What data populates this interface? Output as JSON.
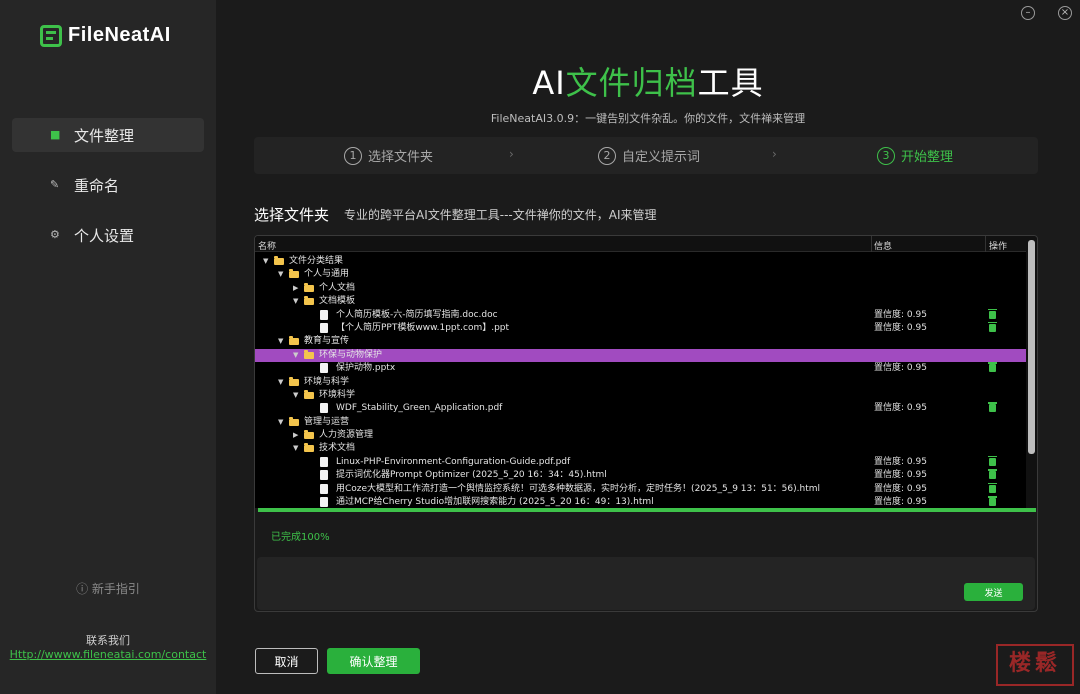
{
  "app": {
    "name": "FileNeatAI",
    "title_prefix": "AI",
    "title_green": "文件归档",
    "title_suffix": "工具",
    "subtitle": "FileNeatAI3.0.9：一键告别文件杂乱。你的文件，文件禅来管理"
  },
  "sidebar": {
    "items": [
      {
        "label": "文件整理",
        "icon": "folder-icon",
        "active": true
      },
      {
        "label": "重命名",
        "icon": "edit-icon",
        "active": false
      },
      {
        "label": "个人设置",
        "icon": "gear-icon",
        "active": false
      }
    ],
    "guide": "新手指引",
    "contact_title": "联系我们",
    "contact_link": "Http://wwww.fileneatai.com/contact"
  },
  "steps": [
    {
      "num": "1",
      "label": "选择文件夹"
    },
    {
      "num": "2",
      "label": "自定义提示词"
    },
    {
      "num": "3",
      "label": "开始整理"
    }
  ],
  "section": {
    "title": "选择文件夹",
    "desc": "专业的跨平台AI文件整理工具---文件禅你的文件，AI来管理"
  },
  "tree": {
    "headers": {
      "name": "名称",
      "info": "信息",
      "action": "操作"
    },
    "rows": [
      {
        "name": "文件分类结果",
        "kind": "folder",
        "level": 0,
        "arrow": "▼",
        "info": ""
      },
      {
        "name": "个人与通用",
        "kind": "folder",
        "level": 1,
        "arrow": "▼",
        "info": ""
      },
      {
        "name": "个人文档",
        "kind": "folder",
        "level": 2,
        "arrow": "▶",
        "info": ""
      },
      {
        "name": "文档模板",
        "kind": "folder",
        "level": 2,
        "arrow": "▼",
        "info": ""
      },
      {
        "name": "个人简历模板-六-简历填写指南.doc.doc",
        "kind": "file",
        "level": 3,
        "info": "置信度: 0.95"
      },
      {
        "name": "【个人简历PPT模板www.1ppt.com】.ppt",
        "kind": "file",
        "level": 3,
        "info": "置信度: 0.95"
      },
      {
        "name": "教育与宣传",
        "kind": "folder",
        "level": 1,
        "arrow": "▼",
        "info": ""
      },
      {
        "name": "环保与动物保护",
        "kind": "folder",
        "level": 2,
        "arrow": "▼",
        "info": "",
        "selected": true
      },
      {
        "name": "保护动物.pptx",
        "kind": "file",
        "level": 3,
        "info": "置信度: 0.95"
      },
      {
        "name": "环境与科学",
        "kind": "folder",
        "level": 1,
        "arrow": "▼",
        "info": ""
      },
      {
        "name": "环境科学",
        "kind": "folder",
        "level": 2,
        "arrow": "▼",
        "info": ""
      },
      {
        "name": "WDF_Stability_Green_Application.pdf",
        "kind": "file",
        "level": 3,
        "info": "置信度: 0.95"
      },
      {
        "name": "管理与运营",
        "kind": "folder",
        "level": 1,
        "arrow": "▼",
        "info": ""
      },
      {
        "name": "人力资源管理",
        "kind": "folder",
        "level": 2,
        "arrow": "▶",
        "info": ""
      },
      {
        "name": "技术文档",
        "kind": "folder",
        "level": 2,
        "arrow": "▼",
        "info": ""
      },
      {
        "name": "Linux-PHP-Environment-Configuration-Guide.pdf.pdf",
        "kind": "file",
        "level": 3,
        "info": "置信度: 0.95"
      },
      {
        "name": "提示词优化器Prompt Optimizer (2025_5_20 16：34：45).html",
        "kind": "file",
        "level": 3,
        "info": "置信度: 0.95"
      },
      {
        "name": "用Coze大模型和工作流打造一个舆情监控系统！可选多种数据源，实时分析，定时任务！(2025_5_9 13：51：56).html",
        "kind": "file",
        "level": 3,
        "info": "置信度: 0.95"
      },
      {
        "name": "通过MCP给Cherry Studio增加联网搜索能力 (2025_5_20 16：49：13).html",
        "kind": "file",
        "level": 3,
        "info": "置信度: 0.95"
      }
    ]
  },
  "progress": {
    "value": 1.0,
    "label": "已完成100%",
    "color": "#3ec14a"
  },
  "buttons": {
    "send": "发送",
    "cancel": "取消",
    "confirm": "确认整理"
  },
  "colors": {
    "accent": "#3ec14a",
    "selection": "#a14bc0",
    "folder": "#f3c44c"
  },
  "stamp": "楼鬆"
}
